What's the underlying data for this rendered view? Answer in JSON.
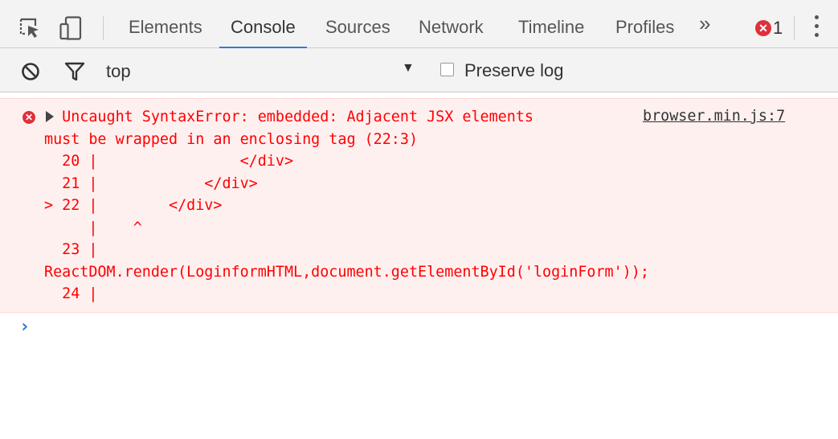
{
  "toolbar": {
    "tabs": [
      "Elements",
      "Console",
      "Sources",
      "Network",
      "Timeline",
      "Profiles"
    ],
    "active_tab": "Console",
    "more_tabs": "»",
    "error_count": "1"
  },
  "filter": {
    "context": "top",
    "context_arrow": "▼",
    "preserve_log_label": "Preserve log",
    "preserve_log_checked": false
  },
  "console": {
    "error": {
      "expand_glyph": "▶",
      "lines": [
        "  Uncaught SyntaxError: embedded: Adjacent JSX elements",
        "must be wrapped in an enclosing tag (22:3)",
        "  20 |                </div>",
        "  21 |            </div>",
        "> 22 |        </div>",
        "     |    ^",
        "  23 |",
        "ReactDOM.render(LoginformHTML,document.getElementById('loginForm'));",
        "  24 |"
      ],
      "source": "browser.min.js:7"
    },
    "prompt": "›"
  },
  "colors": {
    "error_text": "#ff0000",
    "error_bg": "#fff0f0",
    "active_tab_underline": "#3879d9",
    "prompt": "#2b6fe0"
  },
  "icons": {
    "inspect": "inspect-element-icon",
    "device": "device-mode-icon",
    "clear": "clear-console-icon",
    "filter": "filter-icon",
    "error": "error-icon",
    "menu": "more-menu-icon"
  }
}
